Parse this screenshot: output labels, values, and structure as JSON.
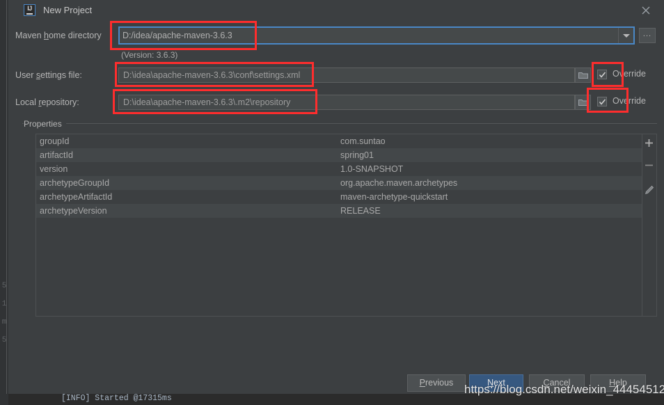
{
  "window": {
    "title": "New Project",
    "app_icon": "intellij-idea-icon",
    "close_icon": "close-icon"
  },
  "form": {
    "maven_home": {
      "label_before": "Maven ",
      "label_mnemonic": "h",
      "label_after": "ome directory",
      "value": "D:/idea/apache-maven-3.6.3",
      "dropdown_icon": "chevron-down-icon",
      "ellipsis_label": "...",
      "version_note": "(Version: 3.6.3)"
    },
    "user_settings": {
      "label_before": "User ",
      "label_mnemonic": "s",
      "label_after": "ettings file:",
      "value": "D:\\idea\\apache-maven-3.6.3\\conf\\settings.xml",
      "browse_icon": "folder-icon",
      "override_label": "Override",
      "override_checked": true
    },
    "local_repository": {
      "label_before": "Local ",
      "label_mnemonic": "r",
      "label_after": "epository:",
      "value": "D:\\idea\\apache-maven-3.6.3\\.m2\\repository",
      "browse_icon": "folder-icon",
      "override_label": "Override",
      "override_checked": true
    }
  },
  "properties": {
    "legend": "Properties",
    "rows": [
      {
        "key": "groupId",
        "value": "com.suntao"
      },
      {
        "key": "artifactId",
        "value": "spring01"
      },
      {
        "key": "version",
        "value": "1.0-SNAPSHOT"
      },
      {
        "key": "archetypeGroupId",
        "value": "org.apache.maven.archetypes"
      },
      {
        "key": "archetypeArtifactId",
        "value": "maven-archetype-quickstart"
      },
      {
        "key": "archetypeVersion",
        "value": "RELEASE"
      }
    ],
    "toolbar": [
      {
        "name": "add-property-button",
        "icon": "plus-icon"
      },
      {
        "name": "remove-property-button",
        "icon": "minus-icon"
      },
      {
        "name": "edit-property-button",
        "icon": "pencil-icon"
      }
    ]
  },
  "buttons": {
    "previous": {
      "before": "",
      "mnemonic": "P",
      "after": "revious"
    },
    "next": {
      "before": "",
      "mnemonic": "N",
      "after": "ext"
    },
    "cancel": {
      "before": "",
      "mnemonic": "C",
      "after": "ancel"
    },
    "help": {
      "before": "",
      "mnemonic": "H",
      "after": "elp"
    }
  },
  "background": {
    "console_line": "[INFO] Started @17315ms",
    "gutter_chars": [
      "5",
      "1",
      "m",
      "5"
    ]
  },
  "watermark": "https://blog.csdn.net/weixin_44454512",
  "colors": {
    "dialog_bg": "#3c3f41",
    "editor_bg": "#2b2b2b",
    "field_bg": "#45494a",
    "focus_border": "#4a88c7",
    "primary_button": "#365880",
    "annotation": "#ff2d2d",
    "text": "#bbbbbb"
  }
}
